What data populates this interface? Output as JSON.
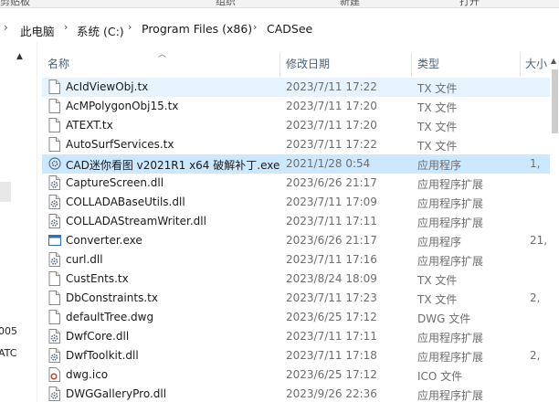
{
  "ribbon": {
    "items": [
      "剪贴板",
      "组织",
      "新建",
      "打开"
    ]
  },
  "address": {
    "breadcrumbs": [
      "此电脑",
      "系统 (C:)",
      "Program Files (x86)",
      "CADSee"
    ],
    "separator": "›"
  },
  "nav": {
    "fragments": [
      "005",
      "ATC"
    ]
  },
  "columns": {
    "name": "名称",
    "date": "修改日期",
    "type": "类型",
    "size": "大小"
  },
  "files": [
    {
      "name": "AcIdViewObj.tx",
      "date": "2023/7/11 17:22",
      "type": "TX 文件",
      "size": "",
      "icon": "file-icon"
    },
    {
      "name": "AcMPolygonObj15.tx",
      "date": "2023/7/11 17:20",
      "type": "TX 文件",
      "size": "",
      "icon": "file-icon"
    },
    {
      "name": "ATEXT.tx",
      "date": "2023/7/11 17:20",
      "type": "TX 文件",
      "size": "",
      "icon": "file-icon"
    },
    {
      "name": "AutoSurfServices.tx",
      "date": "2023/7/11 17:22",
      "type": "TX 文件",
      "size": "",
      "icon": "file-icon"
    },
    {
      "name": "CAD迷你看图 v2021R1 x64 破解补丁.exe",
      "date": "2021/1/28 0:54",
      "type": "应用程序",
      "size": "1,",
      "icon": "exe-gear-icon"
    },
    {
      "name": "CaptureScreen.dll",
      "date": "2023/6/26 21:17",
      "type": "应用程序扩展",
      "size": "",
      "icon": "dll-gear-icon"
    },
    {
      "name": "COLLADABaseUtils.dll",
      "date": "2023/7/11 17:09",
      "type": "应用程序扩展",
      "size": "",
      "icon": "dll-gear-icon"
    },
    {
      "name": "COLLADAStreamWriter.dll",
      "date": "2023/7/11 17:11",
      "type": "应用程序扩展",
      "size": "",
      "icon": "dll-gear-icon"
    },
    {
      "name": "Converter.exe",
      "date": "2023/6/26 21:17",
      "type": "应用程序",
      "size": "21,",
      "icon": "exe-window-icon"
    },
    {
      "name": "curl.dll",
      "date": "2023/7/11 17:16",
      "type": "应用程序扩展",
      "size": "",
      "icon": "dll-gear-icon"
    },
    {
      "name": "CustEnts.tx",
      "date": "2023/8/24 18:09",
      "type": "TX 文件",
      "size": "",
      "icon": "file-icon"
    },
    {
      "name": "DbConstraints.tx",
      "date": "2023/7/11 17:23",
      "type": "TX 文件",
      "size": "2,",
      "icon": "file-icon"
    },
    {
      "name": "defaultTree.dwg",
      "date": "2023/6/25 17:12",
      "type": "DWG 文件",
      "size": "",
      "icon": "file-icon"
    },
    {
      "name": "DwfCore.dll",
      "date": "2023/7/11 17:11",
      "type": "应用程序扩展",
      "size": "",
      "icon": "dll-gear-icon"
    },
    {
      "name": "DwfToolkit.dll",
      "date": "2023/7/11 17:18",
      "type": "应用程序扩展",
      "size": "2,",
      "icon": "dll-gear-icon"
    },
    {
      "name": "dwg.ico",
      "date": "2023/6/25 17:12",
      "type": "ICO 文件",
      "size": "",
      "icon": "ico-file-icon"
    },
    {
      "name": "DWGGalleryPro.dll",
      "date": "2023/9/26 22:36",
      "type": "应用程序扩展",
      "size": "",
      "icon": "dll-gear-icon"
    }
  ],
  "colors": {
    "hover_row": "#e5f3ff",
    "selected_row": "#cce8ff",
    "header_text": "#4c607a",
    "meta_text": "#6d6d6d"
  }
}
